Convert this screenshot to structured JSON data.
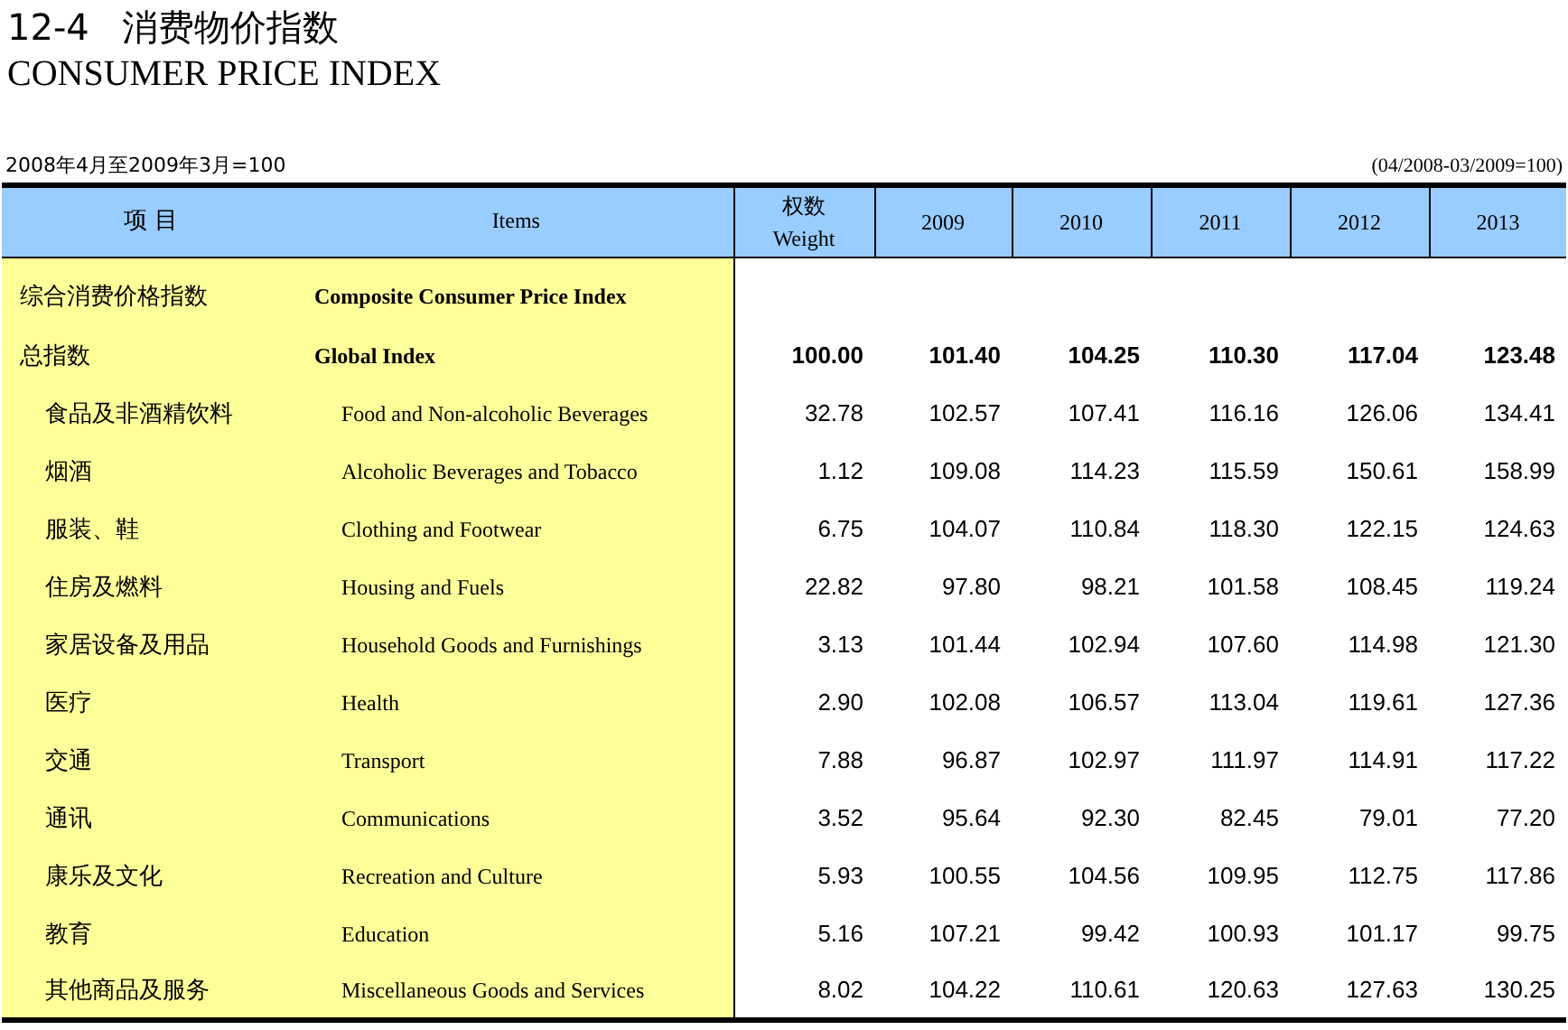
{
  "title": {
    "number": "12-4",
    "zh": "消费物价指数",
    "en": "CONSUMER PRICE INDEX"
  },
  "base_note": {
    "zh": "2008年4月至2009年3月=100",
    "en": "(04/2008-03/2009=100)"
  },
  "table": {
    "columns": [
      {
        "label": "项 目"
      },
      {
        "label": "Items"
      },
      {
        "label": "权数",
        "label_2": "Weight"
      },
      {
        "label": "2009"
      },
      {
        "label": "2010"
      },
      {
        "label": "2011"
      },
      {
        "label": "2012"
      },
      {
        "label": "2013"
      }
    ],
    "rows": [
      {
        "kind": "section",
        "zh": "综合消费价格指数",
        "en": "Composite Consumer Price Index"
      },
      {
        "kind": "total",
        "zh": "总指数",
        "en": "Global Index",
        "values": [
          "100.00",
          "101.40",
          "104.25",
          "110.30",
          "117.04",
          "123.48"
        ]
      },
      {
        "kind": "item",
        "zh": "食品及非酒精饮料",
        "en": "Food and Non-alcoholic Beverages",
        "values": [
          "32.78",
          "102.57",
          "107.41",
          "116.16",
          "126.06",
          "134.41"
        ]
      },
      {
        "kind": "item",
        "zh": "烟酒",
        "en": "Alcoholic Beverages and Tobacco",
        "values": [
          "1.12",
          "109.08",
          "114.23",
          "115.59",
          "150.61",
          "158.99"
        ]
      },
      {
        "kind": "item",
        "zh": "服装、鞋",
        "en": "Clothing and Footwear",
        "values": [
          "6.75",
          "104.07",
          "110.84",
          "118.30",
          "122.15",
          "124.63"
        ]
      },
      {
        "kind": "item",
        "zh": "住房及燃料",
        "en": "Housing and Fuels",
        "values": [
          "22.82",
          "97.80",
          "98.21",
          "101.58",
          "108.45",
          "119.24"
        ]
      },
      {
        "kind": "item",
        "zh": "家居设备及用品",
        "en": "Household Goods and Furnishings",
        "values": [
          "3.13",
          "101.44",
          "102.94",
          "107.60",
          "114.98",
          "121.30"
        ]
      },
      {
        "kind": "item",
        "zh": "医疗",
        "en": "Health",
        "values": [
          "2.90",
          "102.08",
          "106.57",
          "113.04",
          "119.61",
          "127.36"
        ]
      },
      {
        "kind": "item",
        "zh": "交通",
        "en": "Transport",
        "values": [
          "7.88",
          "96.87",
          "102.97",
          "111.97",
          "114.91",
          "117.22"
        ]
      },
      {
        "kind": "item",
        "zh": "通讯",
        "en": "Communications",
        "values": [
          "3.52",
          "95.64",
          "92.30",
          "82.45",
          "79.01",
          "77.20"
        ]
      },
      {
        "kind": "item",
        "zh": "康乐及文化",
        "en": "Recreation and Culture",
        "values": [
          "5.93",
          "100.55",
          "104.56",
          "109.95",
          "112.75",
          "117.86"
        ]
      },
      {
        "kind": "item",
        "zh": "教育",
        "en": "Education",
        "values": [
          "5.16",
          "107.21",
          "99.42",
          "100.93",
          "101.17",
          "99.75"
        ]
      },
      {
        "kind": "item",
        "zh": "其他商品及服务",
        "en": "Miscellaneous Goods and Services",
        "values": [
          "8.02",
          "104.22",
          "110.61",
          "120.63",
          "127.63",
          "130.25"
        ]
      }
    ]
  }
}
